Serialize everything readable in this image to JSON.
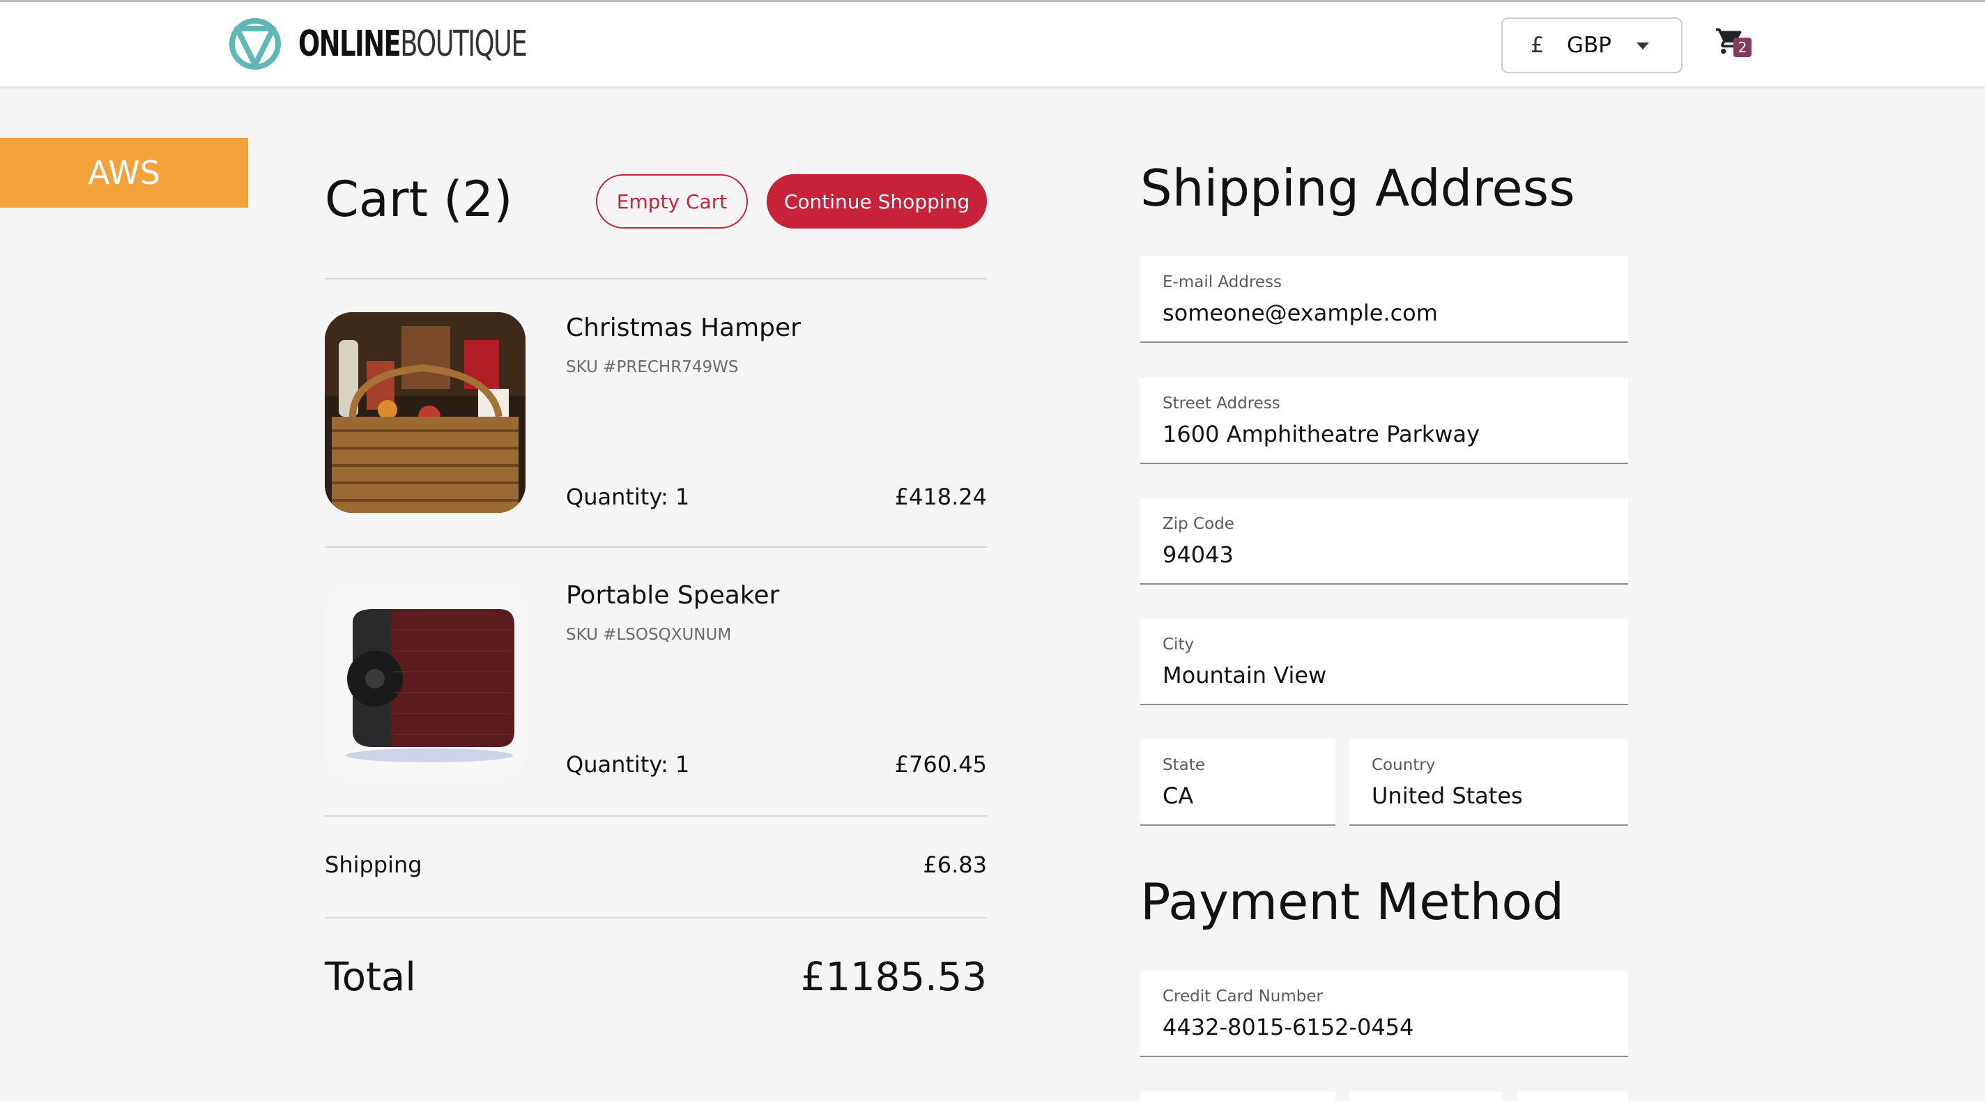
{
  "header": {
    "logo_bold": "ONLINE",
    "logo_thin": "BOUTIQUE",
    "currency_symbol": "£",
    "currency_code": "GBP",
    "cart_count": "2"
  },
  "platform": {
    "name": "AWS",
    "color": "#f3a23b"
  },
  "cart": {
    "title": "Cart (2)",
    "empty_label": "Empty Cart",
    "continue_label": "Continue Shopping",
    "items": [
      {
        "name": "Christmas Hamper",
        "sku": "SKU #PRECHR749WS",
        "quantity": "Quantity: 1",
        "price": "£418.24"
      },
      {
        "name": "Portable Speaker",
        "sku": "SKU #LSOSQXUNUM",
        "quantity": "Quantity: 1",
        "price": "£760.45"
      }
    ],
    "shipping_label": "Shipping",
    "shipping_value": "£6.83",
    "total_label": "Total",
    "total_value": "£1185.53"
  },
  "shipping": {
    "title": "Shipping Address",
    "email_label": "E-mail Address",
    "email_value": "someone@example.com",
    "street_label": "Street Address",
    "street_value": "1600 Amphitheatre Parkway",
    "zip_label": "Zip Code",
    "zip_value": "94043",
    "city_label": "City",
    "city_value": "Mountain View",
    "state_label": "State",
    "state_value": "CA",
    "country_label": "Country",
    "country_value": "United States"
  },
  "payment": {
    "title": "Payment Method",
    "card_label": "Credit Card Number",
    "card_value": "4432-8015-6152-0454"
  },
  "colors": {
    "accent": "#c8223a",
    "logo": "#5fb8b6",
    "badge": "#853b5c"
  }
}
